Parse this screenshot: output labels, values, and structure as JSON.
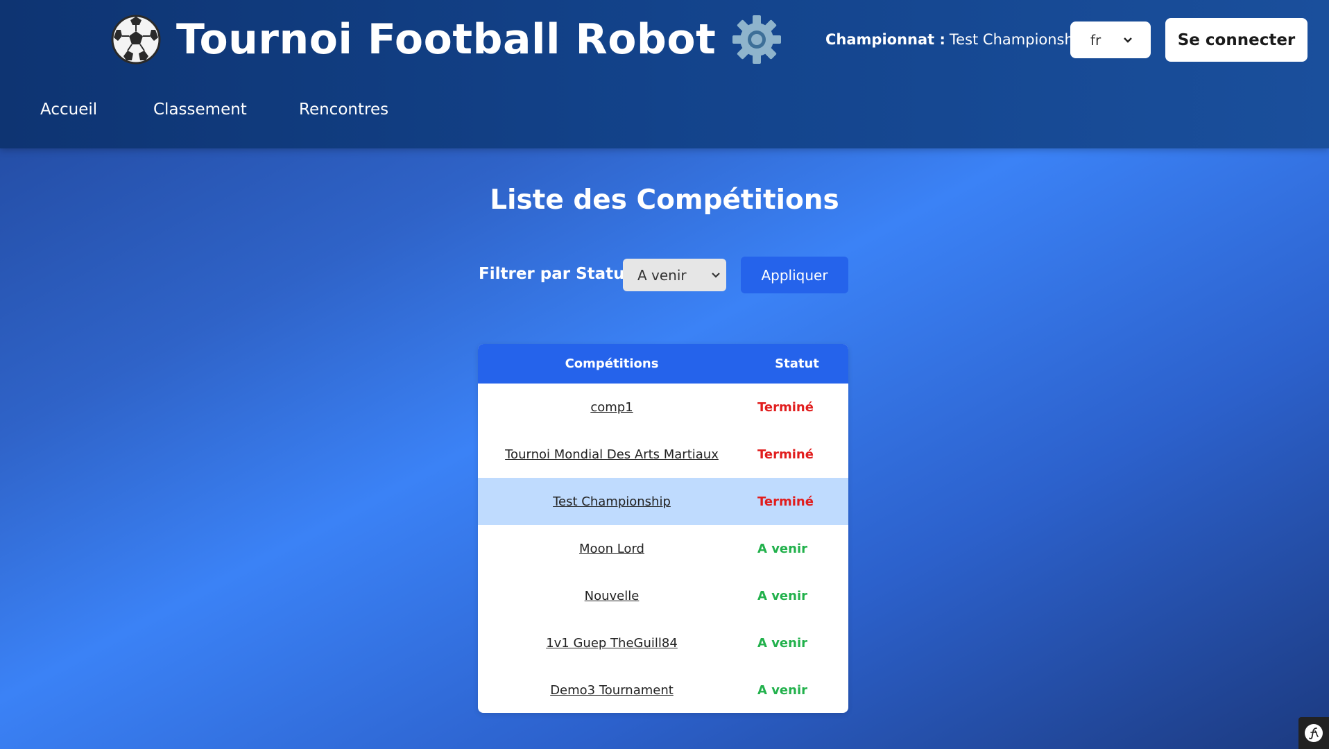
{
  "header": {
    "title": "Tournoi Football Robot",
    "championship_label": "Championnat :",
    "championship_value": "Test Championship",
    "language": "fr",
    "login_label": "Se connecter"
  },
  "nav": {
    "items": [
      {
        "label": "Accueil"
      },
      {
        "label": "Classement"
      },
      {
        "label": "Rencontres"
      }
    ]
  },
  "main": {
    "title": "Liste des Compétitions",
    "filter_label": "Filtrer par Statut",
    "filter_value": "A venir",
    "apply_label": "Appliquer",
    "table": {
      "headers": {
        "competition": "Compétitions",
        "status": "Statut"
      },
      "rows": [
        {
          "name": "comp1",
          "status": "Terminé"
        },
        {
          "name": "Tournoi Mondial Des Arts Martiaux",
          "status": "Terminé"
        },
        {
          "name": "Test Championship",
          "status": "Terminé"
        },
        {
          "name": "Moon Lord",
          "status": "A venir"
        },
        {
          "name": "Nouvelle",
          "status": "A venir"
        },
        {
          "name": "1v1 Guep TheGuill84",
          "status": "A venir"
        },
        {
          "name": "Demo3 Tournament",
          "status": "A venir"
        }
      ]
    }
  },
  "colors": {
    "header_bg": "#13438b",
    "accent": "#2563eb",
    "status_done": "#e11d1d",
    "status_upcoming": "#22b14c",
    "highlight_row": "#bfdbfe"
  },
  "icons": {
    "brand_left": "soccer-ball-icon",
    "brand_right": "gear-icon",
    "debug_toolbar": "symfony-icon"
  }
}
